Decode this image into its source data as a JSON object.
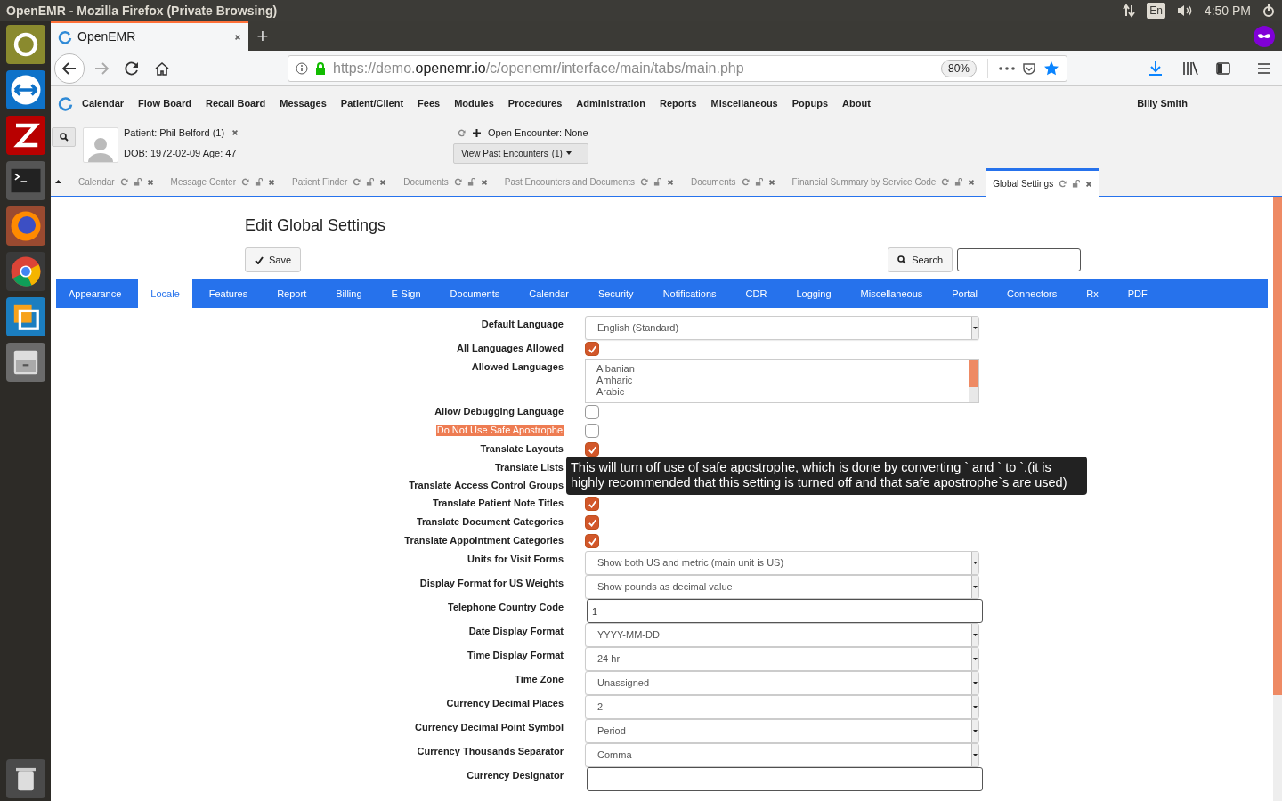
{
  "os_bar": {
    "title": "OpenEMR - Mozilla Firefox (Private Browsing)",
    "keyboard": "En",
    "time": "4:50 PM"
  },
  "browser": {
    "tab_title": "OpenEMR",
    "new_tab": "+",
    "url_host_prefix": "https://demo.",
    "url_host": "openemr.io",
    "url_path": "/c/openemr/interface/main/tabs/main.php",
    "zoom": "80%"
  },
  "menu": {
    "items": [
      "Calendar",
      "Flow Board",
      "Recall Board",
      "Messages",
      "Patient/Client",
      "Fees",
      "Modules",
      "Procedures",
      "Administration",
      "Reports",
      "Miscellaneous",
      "Popups",
      "About"
    ],
    "user": "Billy Smith"
  },
  "patient": {
    "name_label": "Patient: Phil Belford (1)",
    "dob": "DOB: 1972-02-09 Age: 47",
    "encounter": "Open Encounter: None",
    "past_encounters": "View Past Encounters",
    "past_count": "(1)"
  },
  "app_tabs": [
    {
      "label": "Calendar",
      "selected": false
    },
    {
      "label": "Message Center",
      "selected": false
    },
    {
      "label": "Patient Finder",
      "selected": false
    },
    {
      "label": "Documents",
      "selected": false
    },
    {
      "label": "Past Encounters and Documents",
      "selected": false
    },
    {
      "label": "Documents",
      "selected": false
    },
    {
      "label": "Financial Summary by Service Code",
      "selected": false
    },
    {
      "label": "Global Settings",
      "selected": true
    }
  ],
  "page": {
    "title": "Edit Global Settings",
    "save": "Save",
    "search": "Search"
  },
  "settings_tabs": [
    {
      "label": "Appearance",
      "selected": false
    },
    {
      "label": "Locale",
      "selected": true
    },
    {
      "label": "Features",
      "selected": false
    },
    {
      "label": "Report",
      "selected": false
    },
    {
      "label": "Billing",
      "selected": false
    },
    {
      "label": "E-Sign",
      "selected": false
    },
    {
      "label": "Documents",
      "selected": false
    },
    {
      "label": "Calendar",
      "selected": false
    },
    {
      "label": "Security",
      "selected": false
    },
    {
      "label": "Notifications",
      "selected": false
    },
    {
      "label": "CDR",
      "selected": false
    },
    {
      "label": "Logging",
      "selected": false
    },
    {
      "label": "Miscellaneous",
      "selected": false
    },
    {
      "label": "Portal",
      "selected": false
    },
    {
      "label": "Connectors",
      "selected": false
    },
    {
      "label": "Rx",
      "selected": false
    },
    {
      "label": "PDF",
      "selected": false
    }
  ],
  "settings": [
    {
      "label": "Default Language",
      "kind": "select",
      "value": "English (Standard)"
    },
    {
      "label": "All Languages Allowed",
      "kind": "checkbox",
      "checked": true
    },
    {
      "label": "Allowed Languages",
      "kind": "multiselect",
      "options": [
        "Albanian",
        "Amharic",
        "Arabic"
      ]
    },
    {
      "label": "Allow Debugging Language",
      "kind": "checkbox",
      "checked": false
    },
    {
      "label": "Do Not Use Safe Apostrophe",
      "kind": "checkbox",
      "checked": false,
      "highlighted": true
    },
    {
      "label": "Translate Layouts",
      "kind": "checkbox",
      "checked": true
    },
    {
      "label": "Translate Lists",
      "kind": "covered"
    },
    {
      "label": "Translate Access Control Groups",
      "kind": "covered"
    },
    {
      "label": "Translate Patient Note Titles",
      "kind": "checkbox",
      "checked": true
    },
    {
      "label": "Translate Document Categories",
      "kind": "checkbox",
      "checked": true
    },
    {
      "label": "Translate Appointment Categories",
      "kind": "checkbox",
      "checked": true
    },
    {
      "label": "Units for Visit Forms",
      "kind": "select",
      "value": "Show both US and metric (main unit is US)"
    },
    {
      "label": "Display Format for US Weights",
      "kind": "select",
      "value": "Show pounds as decimal value"
    },
    {
      "label": "Telephone Country Code",
      "kind": "text",
      "value": "1"
    },
    {
      "label": "Date Display Format",
      "kind": "select",
      "value": "YYYY-MM-DD"
    },
    {
      "label": "Time Display Format",
      "kind": "select",
      "value": "24 hr"
    },
    {
      "label": "Time Zone",
      "kind": "select",
      "value": "Unassigned"
    },
    {
      "label": "Currency Decimal Places",
      "kind": "select",
      "value": "2"
    },
    {
      "label": "Currency Decimal Point Symbol",
      "kind": "select",
      "value": "Period"
    },
    {
      "label": "Currency Thousands Separator",
      "kind": "select",
      "value": "Comma"
    },
    {
      "label": "Currency Designator",
      "kind": "text"
    }
  ],
  "tooltip": "This will turn off use of safe apostrophe, which is done by converting ` and ` to `.(it is highly recommended that this setting is turned off and that safe apostrophe`s are used)"
}
